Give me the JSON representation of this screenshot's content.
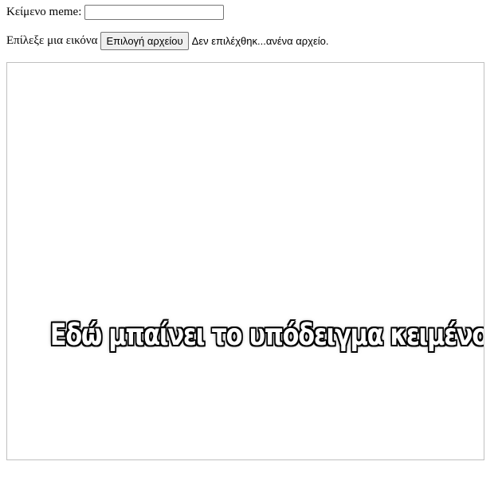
{
  "form": {
    "meme_text_label": "Κείμενο meme:",
    "meme_text_value": "",
    "choose_image_label": "Επίλεξε μια εικόνα",
    "file_button_label": "Επιλογή αρχείου",
    "file_status": "Δεν επιλέχθηκ...ανένα αρχείο."
  },
  "canvas": {
    "meme_placeholder_text": "Εδώ μπαίνει το υπόδειγμα κειμένου",
    "text_color": "#ffffff",
    "text_outline_color": "#000000",
    "border_color": "#c0c0c0"
  }
}
